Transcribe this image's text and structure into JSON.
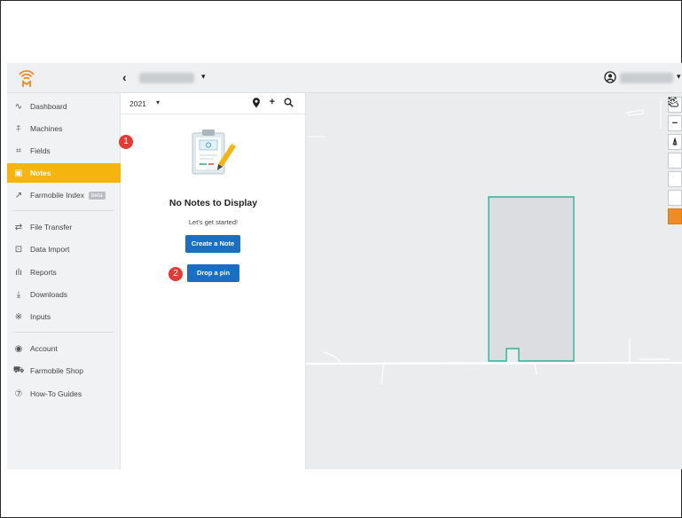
{
  "header": {
    "back_label": "‹",
    "farm_caret": "▾",
    "user_caret": "▾"
  },
  "sidebar": {
    "items": [
      {
        "label": "Dashboard",
        "icon": "pulse-icon",
        "glyph": "∿"
      },
      {
        "label": "Machines",
        "icon": "machine-icon",
        "glyph": "⍏"
      },
      {
        "label": "Fields",
        "icon": "field-icon",
        "glyph": "⌗"
      },
      {
        "label": "Notes",
        "icon": "notes-icon",
        "glyph": "▣",
        "active": true
      },
      {
        "label": "Farmobile Index",
        "icon": "trend-icon",
        "glyph": "↗",
        "badge": "beta"
      },
      {
        "label": "File Transfer",
        "icon": "transfer-icon",
        "glyph": "⇄"
      },
      {
        "label": "Data Import",
        "icon": "import-icon",
        "glyph": "⊡"
      },
      {
        "label": "Reports",
        "icon": "reports-icon",
        "glyph": "ılı"
      },
      {
        "label": "Downloads",
        "icon": "download-icon",
        "glyph": "⤓"
      },
      {
        "label": "Inputs",
        "icon": "inputs-icon",
        "glyph": "※"
      },
      {
        "label": "Account",
        "icon": "account-icon",
        "glyph": "◉"
      },
      {
        "label": "Farmobile Shop",
        "icon": "cart-icon",
        "glyph": "⛟"
      },
      {
        "label": "How-To Guides",
        "icon": "help-icon",
        "glyph": "⑦"
      }
    ]
  },
  "notes_panel": {
    "year": "2021",
    "year_caret": "▾",
    "pin_icon_glyph": "⚲",
    "add_glyph": "+",
    "search_glyph": "⌕",
    "empty_title": "No Notes to Display",
    "empty_subtitle": "Let's get started!",
    "create_button": "Create a Note",
    "pin_button": "Drop a pin"
  },
  "annotations": {
    "badge1": "1",
    "badge2": "2"
  },
  "map_controls": [
    {
      "name": "zoom-in-button",
      "glyph": "+"
    },
    {
      "name": "zoom-out-button",
      "glyph": "−"
    },
    {
      "name": "compass-button",
      "glyph": "⍋"
    },
    {
      "name": "fullscreen-button",
      "glyph": "⛶"
    },
    {
      "name": "globe-button",
      "glyph": "◍"
    },
    {
      "name": "weather-button",
      "glyph": "☼"
    },
    {
      "name": "layers-button",
      "glyph": "◈",
      "active": true
    }
  ],
  "colors": {
    "accent": "#f6b40e",
    "button_blue": "#1a6fc4",
    "badge_red": "#e53935",
    "field_outline": "#2bb39a",
    "layers_orange": "#f08a24"
  }
}
